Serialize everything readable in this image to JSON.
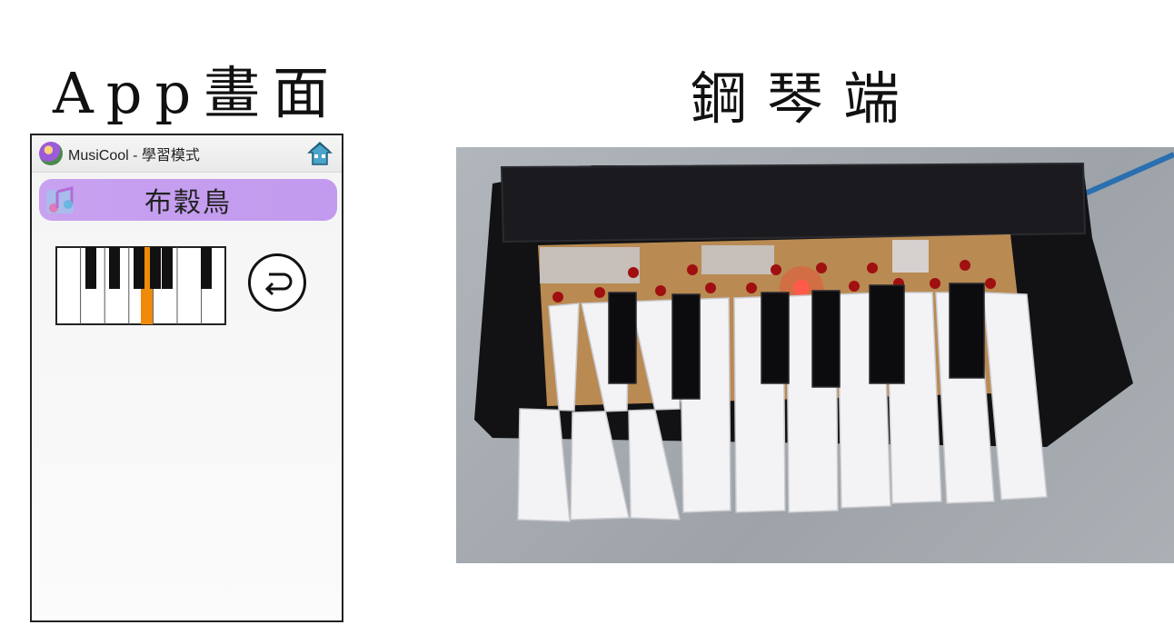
{
  "headings": {
    "app": "App畫面",
    "piano": "鋼琴端"
  },
  "app_screen": {
    "title": "MusiCool - 學習模式",
    "song": "布穀鳥",
    "icons": {
      "app_logo": "app-logo-icon",
      "home": "home-icon",
      "banner": "music-notes-icon",
      "back": "back-arrow-icon"
    },
    "keyboard": {
      "white_keys": 7,
      "highlighted_key": "black-key-3",
      "highlight_color": "#f08a0a"
    }
  },
  "photo": {
    "subject": "physical-piano-photo",
    "lit_led_color": "#ff3a2a"
  }
}
